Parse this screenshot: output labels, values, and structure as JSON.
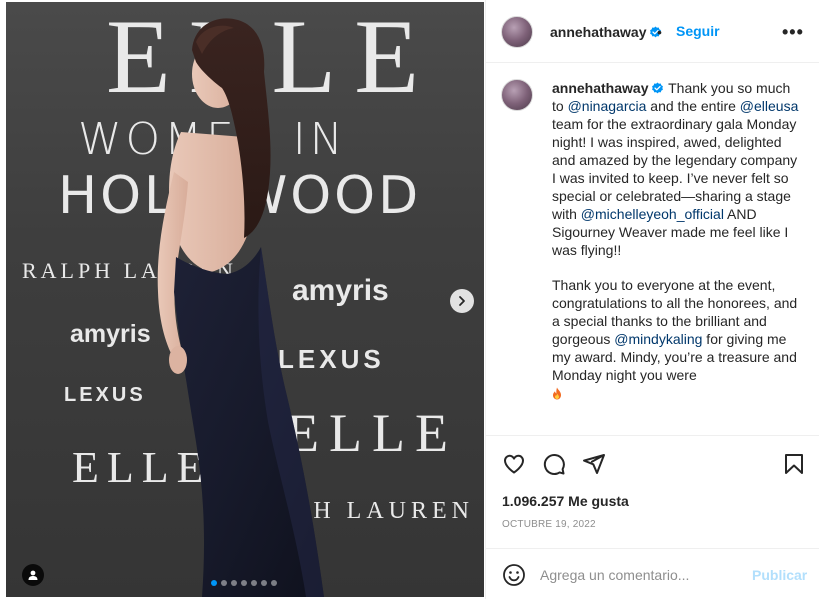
{
  "post": {
    "backdrop": {
      "elle_top": "ELLE",
      "women_in": "WOMEN IN",
      "hollywood": "HOLLYWOOD",
      "ralph_lauren_1": "RALPH LAUREN",
      "amyris_1": "amyris",
      "amyris_2": "amyris",
      "lexus_1": "LEXUS",
      "lexus_2": "LEXUS",
      "elle_mid": "ELLE",
      "elle_low": "ELLE",
      "ralph_lauren_2": "RALPH LAUREN"
    },
    "carousel": {
      "total": 7,
      "active": 1
    }
  },
  "header": {
    "username": "annehathaway",
    "separator": "•",
    "follow_label": "Seguir",
    "more_label": "•••"
  },
  "caption": {
    "username": "annehathaway",
    "p1_a": " Thank you so much to ",
    "mention1": "@ninagarcia",
    "p1_b": " and the entire ",
    "mention2": "@elleusa",
    "p1_c": " team for the extraordinary gala Monday night! I was inspired, awed, delighted and amazed by the legendary company I was invited to keep. I’ve never felt so special or celebrated—sharing a stage with ",
    "mention3": "@michelleyeoh_official",
    "p1_d": " AND Sigourney Weaver made me feel like I was flying!!",
    "p2_a": "Thank you to everyone at the event, congratulations to all the honorees, and a special thanks to the brilliant and gorgeous ",
    "mention4": "@mindykaling",
    "p2_b": " for giving me my award. Mindy, you’re a treasure and Monday night you were"
  },
  "stats": {
    "likes": "1.096.257 Me gusta",
    "date": "OCTUBRE 19, 2022"
  },
  "comment": {
    "placeholder": "Agrega un comentario...",
    "publish_label": "Publicar"
  },
  "colors": {
    "accent": "#0095f6",
    "mention": "#00376b",
    "publish_disabled": "#b2dffc",
    "muted": "#8e8e8e"
  },
  "icons": [
    "verified-badge-icon",
    "heart-icon",
    "comment-icon",
    "share-icon",
    "bookmark-icon",
    "emoji-icon",
    "chevron-right-icon",
    "user-tag-icon",
    "fire-icon"
  ]
}
